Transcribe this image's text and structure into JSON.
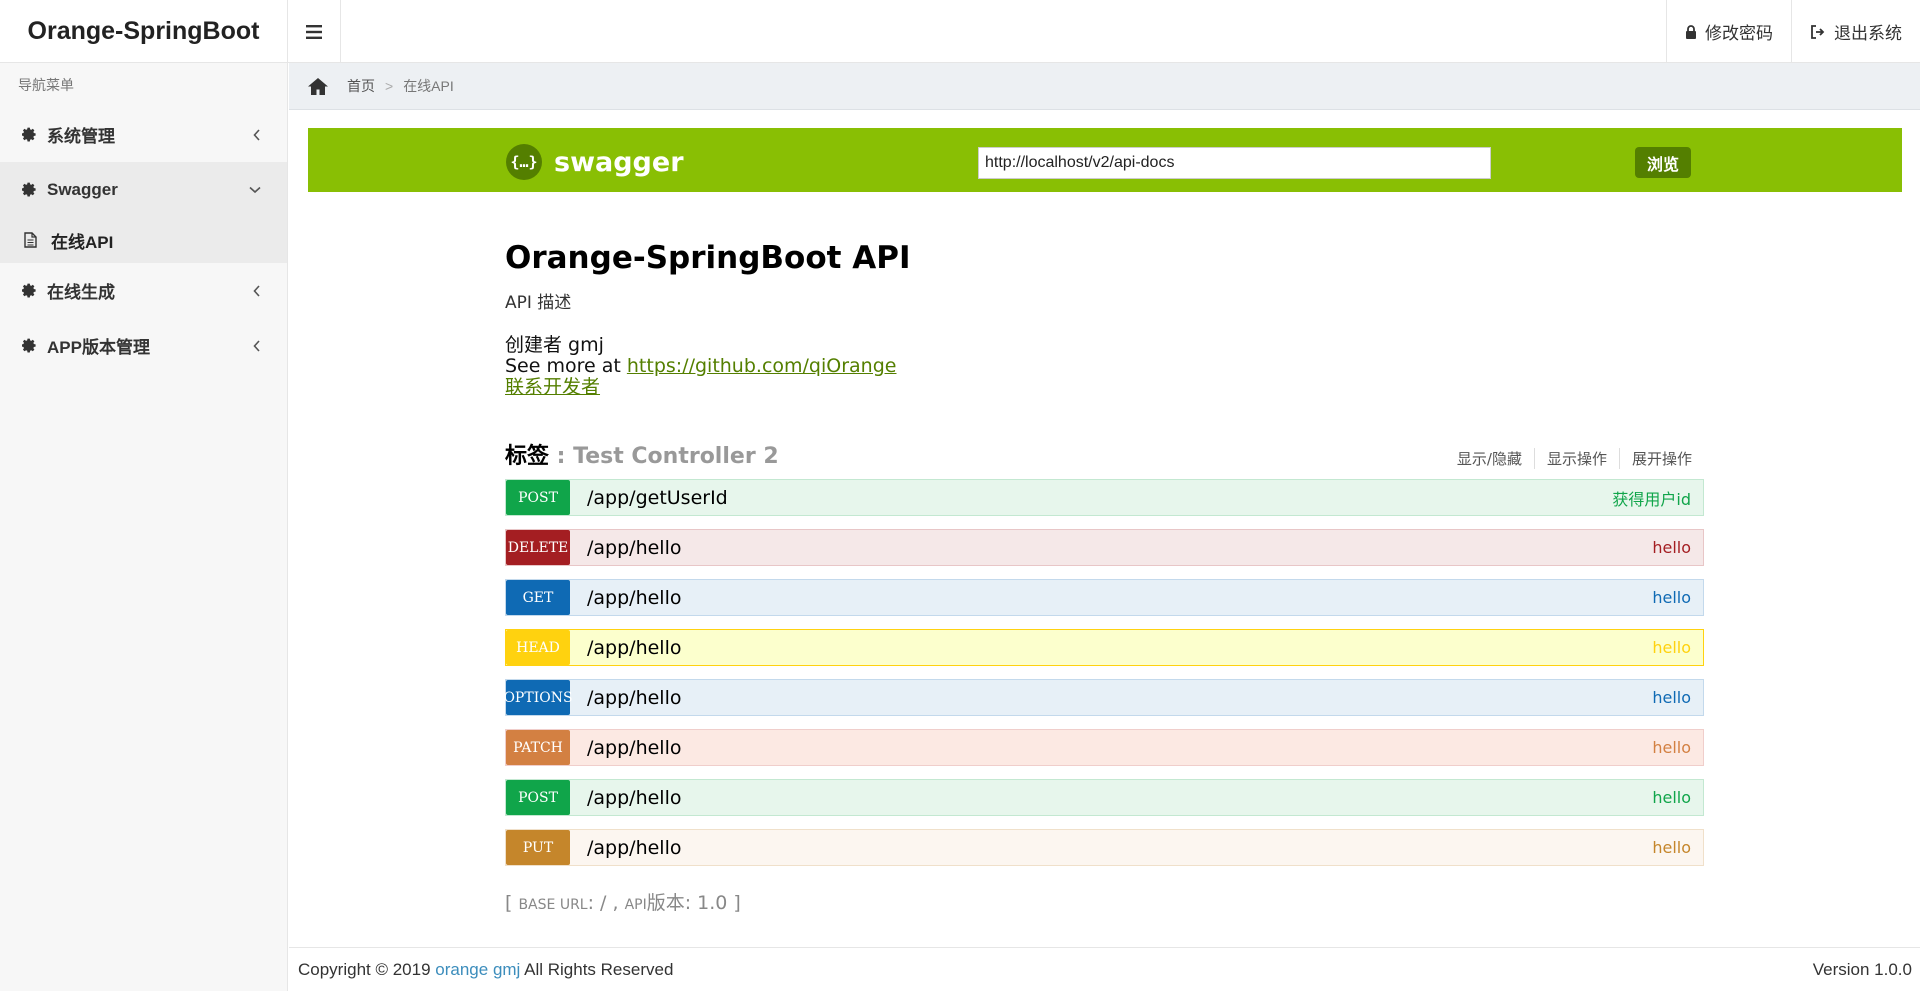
{
  "app": {
    "brand": "Orange-SpringBoot"
  },
  "header": {
    "change_password": "修改密码",
    "logout": "退出系统"
  },
  "sidebar": {
    "header": "导航菜单",
    "items": [
      {
        "label": "系统管理",
        "icon": "gear-icon",
        "expanded": false
      },
      {
        "label": "Swagger",
        "icon": "gear-icon",
        "expanded": true,
        "children": [
          {
            "label": "在线API",
            "icon": "file-text-icon"
          }
        ]
      },
      {
        "label": "在线生成",
        "icon": "gear-icon",
        "expanded": false
      },
      {
        "label": "APP版本管理",
        "icon": "gear-icon",
        "expanded": false
      }
    ]
  },
  "breadcrumb": {
    "home": "首页",
    "separator": ">",
    "current": "在线API"
  },
  "swagger": {
    "logo_text": "swagger",
    "logo_badge": "{…}",
    "url_value": "http://localhost/v2/api-docs",
    "explore_button": "浏览",
    "bar_color": "#89bf04"
  },
  "api": {
    "title": "Orange-SpringBoot API",
    "description": "API 描述",
    "created_by": "创建者 gmj",
    "see_more_prefix": "See more at ",
    "see_more_link": "https://github.com/qiOrange",
    "contact": "联系开发者"
  },
  "tag": {
    "label": "标签",
    "name": " : Test Controller 2",
    "show_hide": "显示/隐藏",
    "list_operations": "显示操作",
    "expand_operations": "展开操作"
  },
  "operations": [
    {
      "method": "POST",
      "path": "/app/getUserId",
      "summary": "获得用户id",
      "method_color": "#10a54a",
      "bg": "#e7f6ec",
      "border": "#c3e8d1",
      "summary_color": "#10a54a"
    },
    {
      "method": "DELETE",
      "path": "/app/hello",
      "summary": "hello",
      "method_color": "#a41e22",
      "bg": "#f5e8e8",
      "border": "#e8c6c7",
      "summary_color": "#a41e22"
    },
    {
      "method": "GET",
      "path": "/app/hello",
      "summary": "hello",
      "method_color": "#0f6ab4",
      "bg": "#e7f0f7",
      "border": "#c3d9ec",
      "summary_color": "#0f6ab4"
    },
    {
      "method": "HEAD",
      "path": "/app/hello",
      "summary": "hello",
      "method_color": "#ffd20f",
      "bg": "#fcffcd",
      "border": "#ffd20f",
      "summary_color": "#ffd20f"
    },
    {
      "method": "OPTIONS",
      "path": "/app/hello",
      "summary": "hello",
      "method_color": "#0f6ab4",
      "bg": "#e7f0f7",
      "border": "#c3d9ec",
      "summary_color": "#0f6ab4"
    },
    {
      "method": "PATCH",
      "path": "/app/hello",
      "summary": "hello",
      "method_color": "#d38042",
      "bg": "#fce9e3",
      "border": "#f0cecb",
      "summary_color": "#d38042"
    },
    {
      "method": "POST",
      "path": "/app/hello",
      "summary": "hello",
      "method_color": "#10a54a",
      "bg": "#e7f6ec",
      "border": "#c3e8d1",
      "summary_color": "#10a54a"
    },
    {
      "method": "PUT",
      "path": "/app/hello",
      "summary": "hello",
      "method_color": "#c5862b",
      "bg": "#fcf6f0",
      "border": "#f0e0ca",
      "summary_color": "#c5862b"
    }
  ],
  "base": {
    "open": "[ ",
    "base_url_label": "BASE URL",
    "base_url_value": ": / , ",
    "api_label": "API",
    "version_text": "版本: 1.0",
    "close": " ]"
  },
  "footer": {
    "copyright_prefix": "Copyright © 2019 ",
    "author": "orange gmj",
    "rights": " All Rights Reserved",
    "version": "Version 1.0.0"
  }
}
